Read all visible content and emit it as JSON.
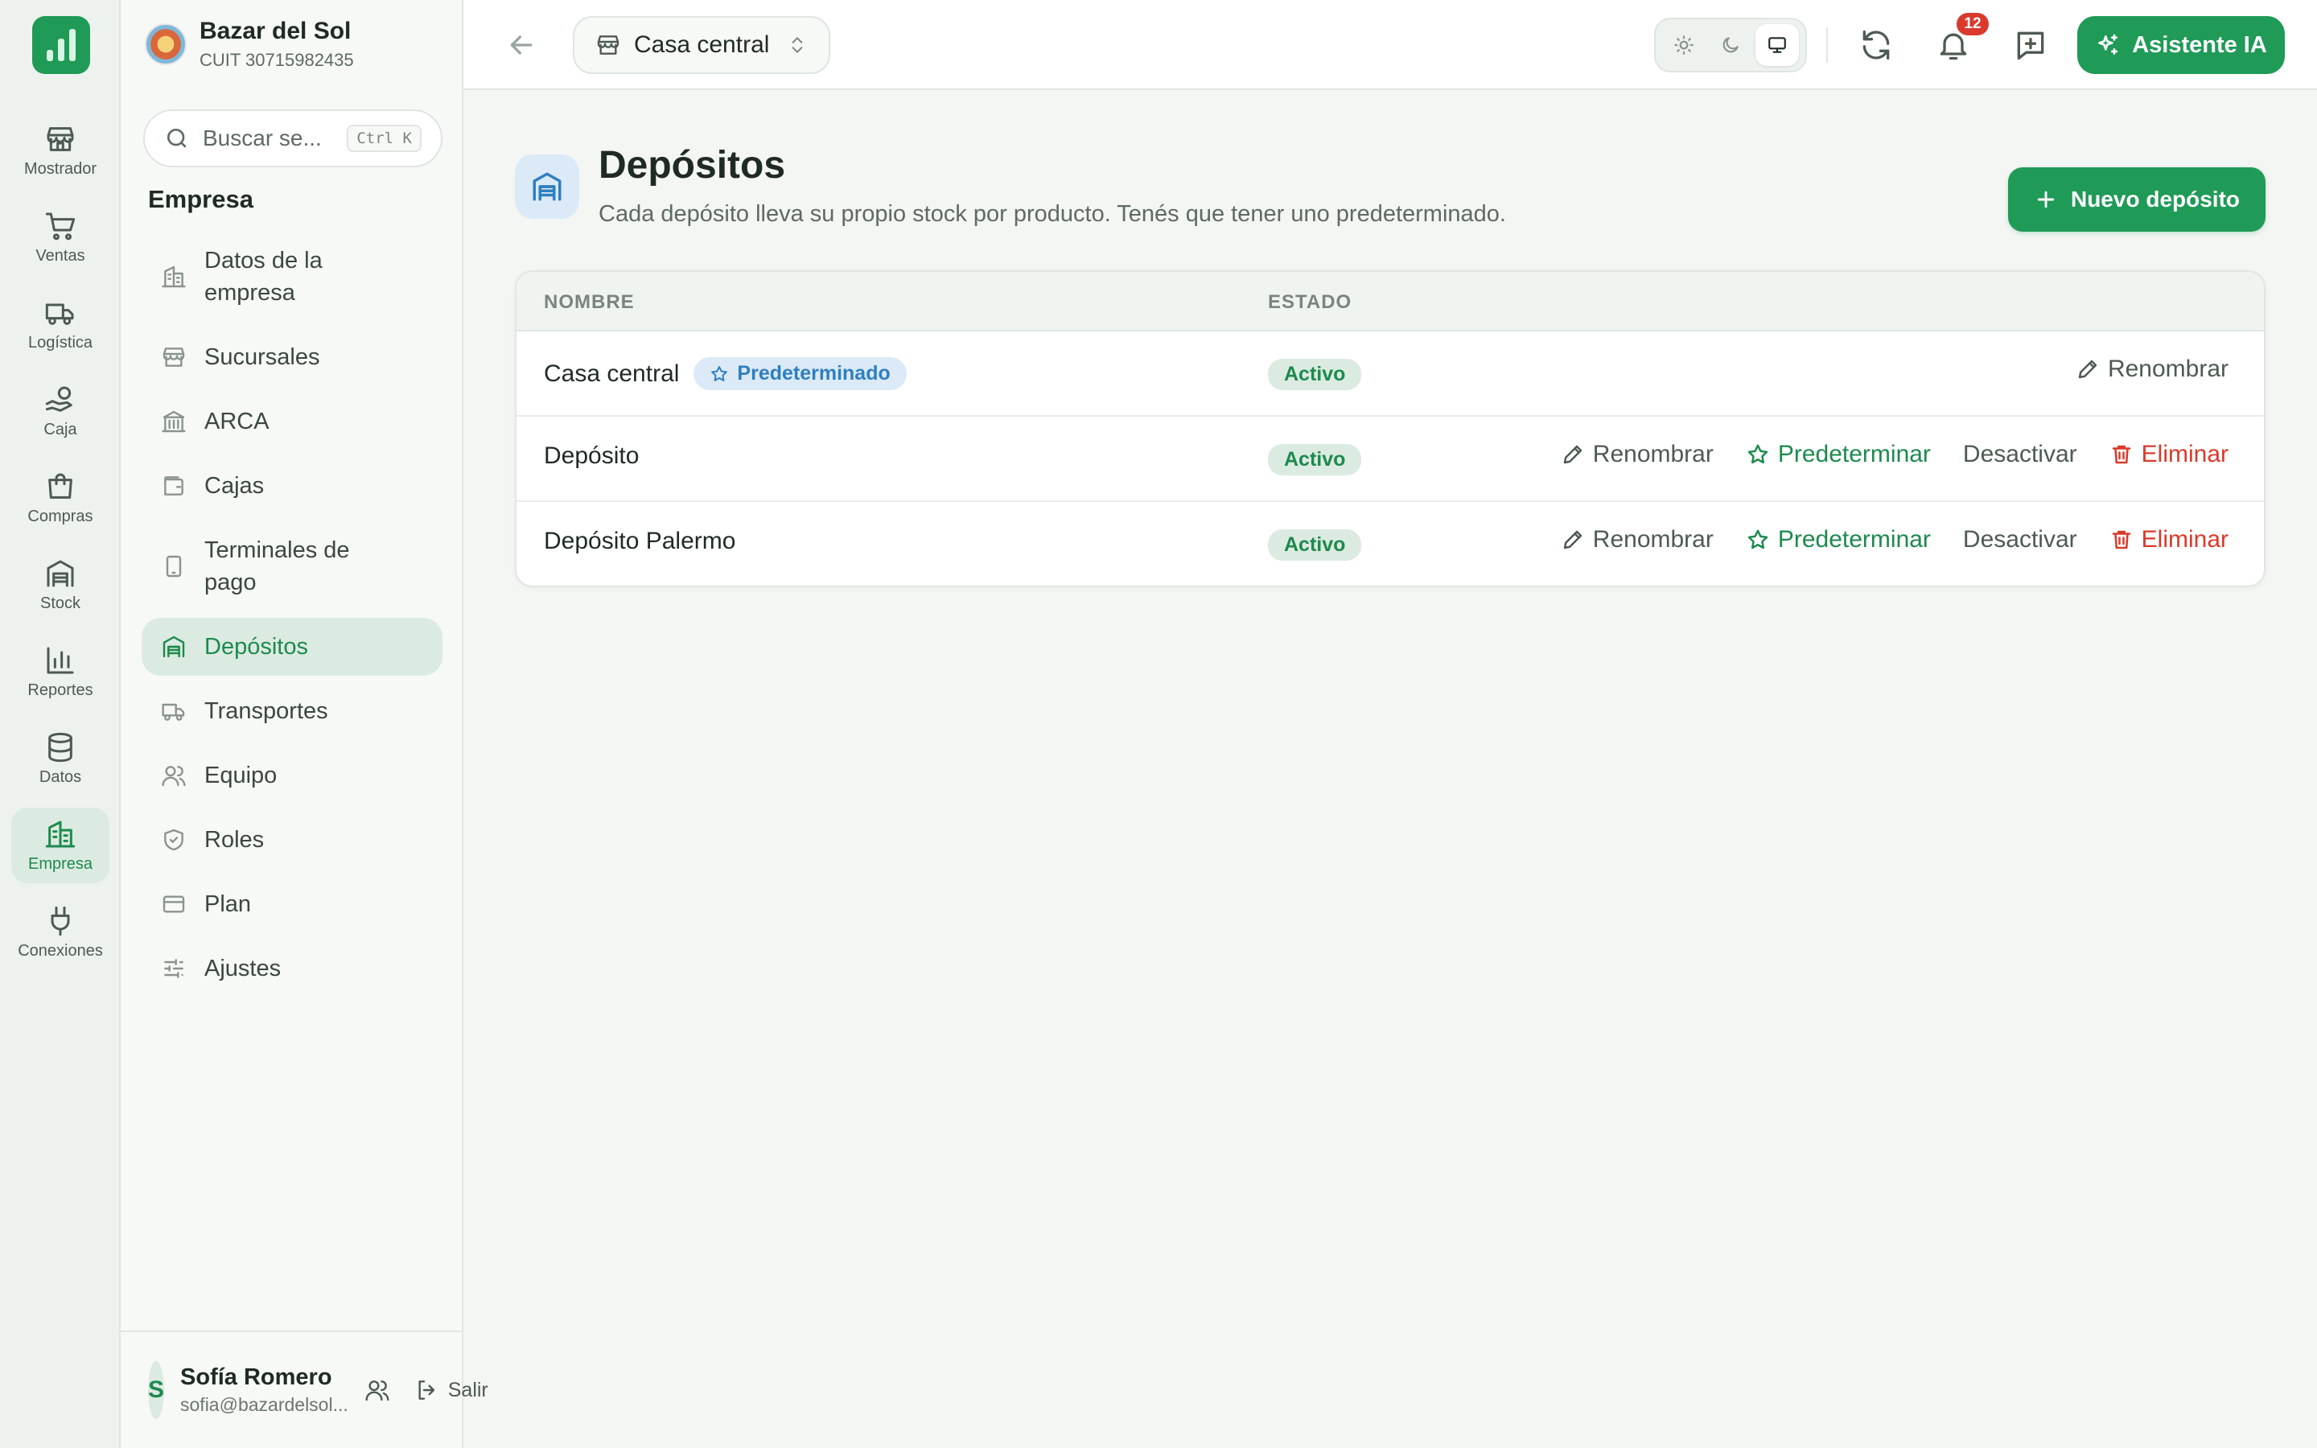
{
  "rail": {
    "items": [
      {
        "label": "Mostrador",
        "icon": "store-icon"
      },
      {
        "label": "Ventas",
        "icon": "cart-icon"
      },
      {
        "label": "Logística",
        "icon": "truck-icon"
      },
      {
        "label": "Caja",
        "icon": "hand-coins-icon"
      },
      {
        "label": "Compras",
        "icon": "bag-icon"
      },
      {
        "label": "Stock",
        "icon": "warehouse-icon"
      },
      {
        "label": "Reportes",
        "icon": "bar-chart-icon"
      },
      {
        "label": "Datos",
        "icon": "database-icon"
      },
      {
        "label": "Empresa",
        "icon": "building-icon",
        "active": true
      },
      {
        "label": "Conexiones",
        "icon": "plug-icon"
      }
    ]
  },
  "org": {
    "name": "Bazar del Sol",
    "cuit": "CUIT 30715982435"
  },
  "search": {
    "placeholder": "Buscar se...",
    "shortcut": "Ctrl K"
  },
  "sidebar": {
    "section_title": "Empresa",
    "items": [
      {
        "label": "Datos de la empresa",
        "icon": "building-icon"
      },
      {
        "label": "Sucursales",
        "icon": "store-icon"
      },
      {
        "label": "ARCA",
        "icon": "landmark-icon"
      },
      {
        "label": "Cajas",
        "icon": "wallet-icon"
      },
      {
        "label": "Terminales de pago",
        "icon": "tablet-icon"
      },
      {
        "label": "Depósitos",
        "icon": "warehouse-icon",
        "active": true
      },
      {
        "label": "Transportes",
        "icon": "truck-icon"
      },
      {
        "label": "Equipo",
        "icon": "users-icon"
      },
      {
        "label": "Roles",
        "icon": "shield-icon"
      },
      {
        "label": "Plan",
        "icon": "credit-card-icon"
      },
      {
        "label": "Ajustes",
        "icon": "sliders-icon"
      }
    ]
  },
  "user": {
    "initial": "S",
    "name": "Sofía Romero",
    "email": "sofia@bazardelsol...",
    "logout_label": "Salir"
  },
  "topbar": {
    "branch": "Casa central",
    "notifications_count": "12",
    "ai_label": "Asistente IA",
    "theme_active": "system"
  },
  "page": {
    "title": "Depósitos",
    "subtitle": "Cada depósito lleva su propio stock por producto. Tenés que tener uno predeterminado.",
    "new_button": "Nuevo depósito"
  },
  "table": {
    "headers": {
      "name": "NOMBRE",
      "status": "ESTADO"
    },
    "rows": [
      {
        "name": "Casa central",
        "default_badge": "Predeterminado",
        "status": "Activo",
        "rename": "Renombrar"
      },
      {
        "name": "Depósito",
        "status": "Activo",
        "rename": "Renombrar",
        "set_default": "Predeterminar",
        "deactivate": "Desactivar",
        "delete": "Eliminar"
      },
      {
        "name": "Depósito Palermo",
        "status": "Activo",
        "rename": "Renombrar",
        "set_default": "Predeterminar",
        "deactivate": "Desactivar",
        "delete": "Eliminar"
      }
    ]
  },
  "colors": {
    "primary": "#1f9a57",
    "danger": "#d93a2b",
    "info": "#2f7fc0"
  }
}
